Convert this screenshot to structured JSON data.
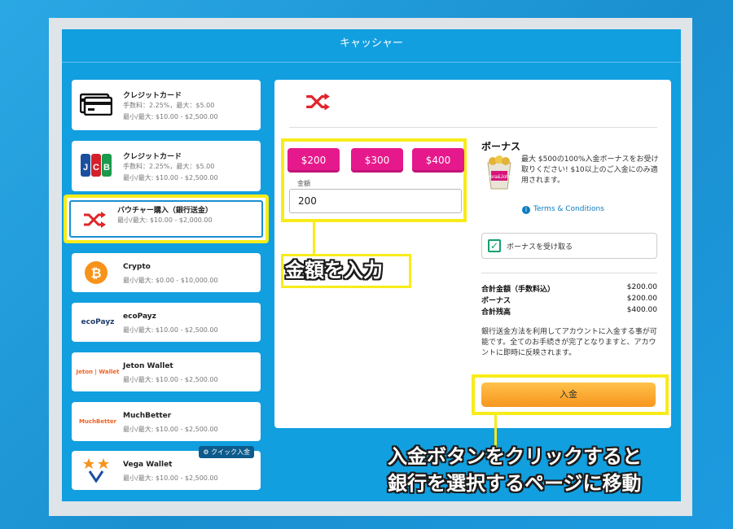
{
  "window": {
    "title": "キャッシャー"
  },
  "methods": [
    {
      "name": "クレジットカード",
      "fee": "手数料：2.25%，最大：$5.00",
      "limit": "最小/最大: $10.00 - $2,500.00",
      "icon": "credit-card-icon"
    },
    {
      "name": "クレジットカード",
      "fee": "手数料：2.25%，最大：$5.00",
      "limit": "最小/最大: $10.00 - $2,500.00",
      "icon": "jcb-logo"
    },
    {
      "name": "バウチャー購入（銀行送金）",
      "limit": "最小/最大: $10.00 - $2,000.00",
      "icon": "shuffle-icon",
      "selected": true
    },
    {
      "name": "Crypto",
      "limit": "最小/最大: $0.00 - $10,000.00",
      "icon": "bitcoin-icon"
    },
    {
      "name": "ecoPayz",
      "limit": "最小/最大: $10.00 - $2,500.00",
      "icon": "ecopayz-logo",
      "logo_text": "ecoPayz"
    },
    {
      "name": "Jeton Wallet",
      "limit": "最小/最大: $10.00 - $2,500.00",
      "icon": "jeton-logo",
      "logo_text": "Jeton | Wallet"
    },
    {
      "name": "MuchBetter",
      "limit": "最小/最大: $10.00 - $2,500.00",
      "icon": "muchbetter-logo",
      "logo_text": "MuchBetter"
    },
    {
      "name": "Vega Wallet",
      "limit": "最小/最大: $10.00 - $2,500.00",
      "icon": "vega-stars-icon",
      "badge": "クイック入金"
    }
  ],
  "deposit": {
    "presets": [
      "$200",
      "$300",
      "$400"
    ],
    "amount_label": "金額",
    "amount_value": "200",
    "button_label": "入金",
    "info_text": "銀行送金方法を利用してアカウントに入金する事が可能です。全てのお手続きが完了となりますと、アカウントに即時に反映されます。"
  },
  "bonus": {
    "title": "ボーナス",
    "description": "最大 $500の100%入金ボーナスをお受け取りください! $10以上のご入金にのみ適用されます。",
    "terms_label": "Terms & Conditions",
    "checkbox_label": "ボーナスを受け取る",
    "checked": true,
    "image_text": "Vera&John"
  },
  "summary": [
    {
      "label": "合計金額（手数料込）",
      "value": "$200.00"
    },
    {
      "label": "ボーナス",
      "value": "$200.00"
    },
    {
      "label": "合計残高",
      "value": "$400.00"
    }
  ],
  "annotations": {
    "amount_callout": "金額を入力",
    "deposit_callout_line1": "入金ボタンをクリックすると",
    "deposit_callout_line2": "銀行を選択するページに移動"
  },
  "colors": {
    "accent_blue": "#119fe0",
    "preset_pink": "#e6198c",
    "deposit_orange": "#f7961f",
    "highlight_yellow": "#f7ec1a",
    "shuffle_red": "#e0252b"
  }
}
